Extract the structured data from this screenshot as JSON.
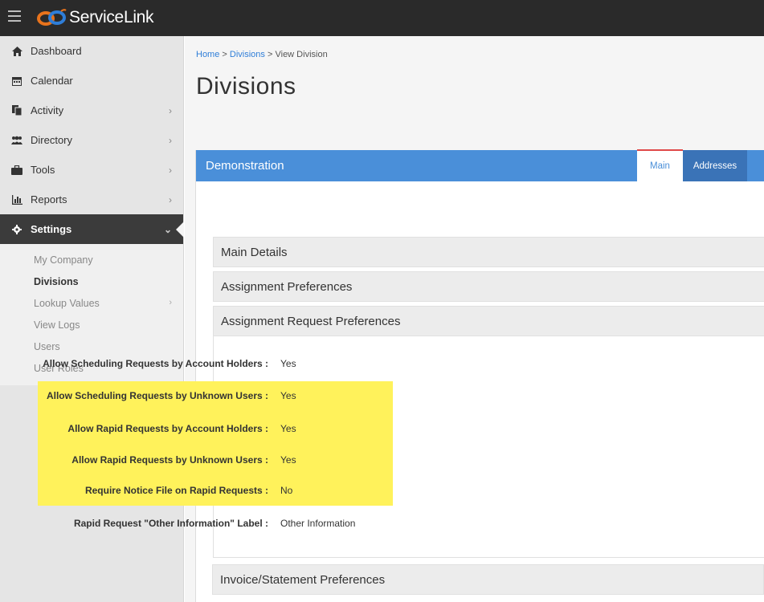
{
  "app": {
    "logo_text_service": "Service",
    "logo_text_link": "Link"
  },
  "sidebar": {
    "items": [
      {
        "label": "Dashboard",
        "icon": "home-icon",
        "has_chevron": false
      },
      {
        "label": "Calendar",
        "icon": "calendar-icon",
        "has_chevron": false
      },
      {
        "label": "Activity",
        "icon": "copy-icon",
        "has_chevron": true
      },
      {
        "label": "Directory",
        "icon": "users-icon",
        "has_chevron": true
      },
      {
        "label": "Tools",
        "icon": "briefcase-icon",
        "has_chevron": true
      },
      {
        "label": "Reports",
        "icon": "bar-chart-icon",
        "has_chevron": true
      },
      {
        "label": "Settings",
        "icon": "gear-icon",
        "has_chevron": true
      }
    ],
    "settings_sub": [
      {
        "label": "My Company"
      },
      {
        "label": "Divisions"
      },
      {
        "label": "Lookup Values"
      },
      {
        "label": "View Logs"
      },
      {
        "label": "Users"
      },
      {
        "label": "User Roles"
      }
    ]
  },
  "breadcrumb": {
    "home": "Home",
    "sep": ">",
    "divisions": "Divisions",
    "current": "View Division"
  },
  "page_title": "Divisions",
  "panel": {
    "title": "Demonstration",
    "tabs": [
      "Main",
      "Addresses"
    ]
  },
  "sections": {
    "main_details": "Main Details",
    "assignment_preferences": "Assignment Preferences",
    "assignment_request_preferences": "Assignment Request Preferences",
    "invoice_preferences": "Invoice/Statement Preferences"
  },
  "fields": [
    {
      "label": "Allow Scheduling Requests by Account Holders :",
      "value": "Yes"
    },
    {
      "label": "Allow Scheduling Requests by Unknown Users :",
      "value": "Yes"
    },
    {
      "label": "Allow Rapid Requests by Account Holders :",
      "value": "Yes"
    },
    {
      "label": "Allow Rapid Requests by Unknown Users :",
      "value": "Yes"
    },
    {
      "label": "Require Notice File on Rapid Requests :",
      "value": "No"
    },
    {
      "label": "Rapid Request \"Other Information\" Label :",
      "value": "Other Information"
    }
  ],
  "colors": {
    "accent_blue": "#4a8fd9",
    "highlight_yellow": "#fff25b",
    "active_tab_border": "#e04848",
    "topbar": "#2a2a2a"
  }
}
